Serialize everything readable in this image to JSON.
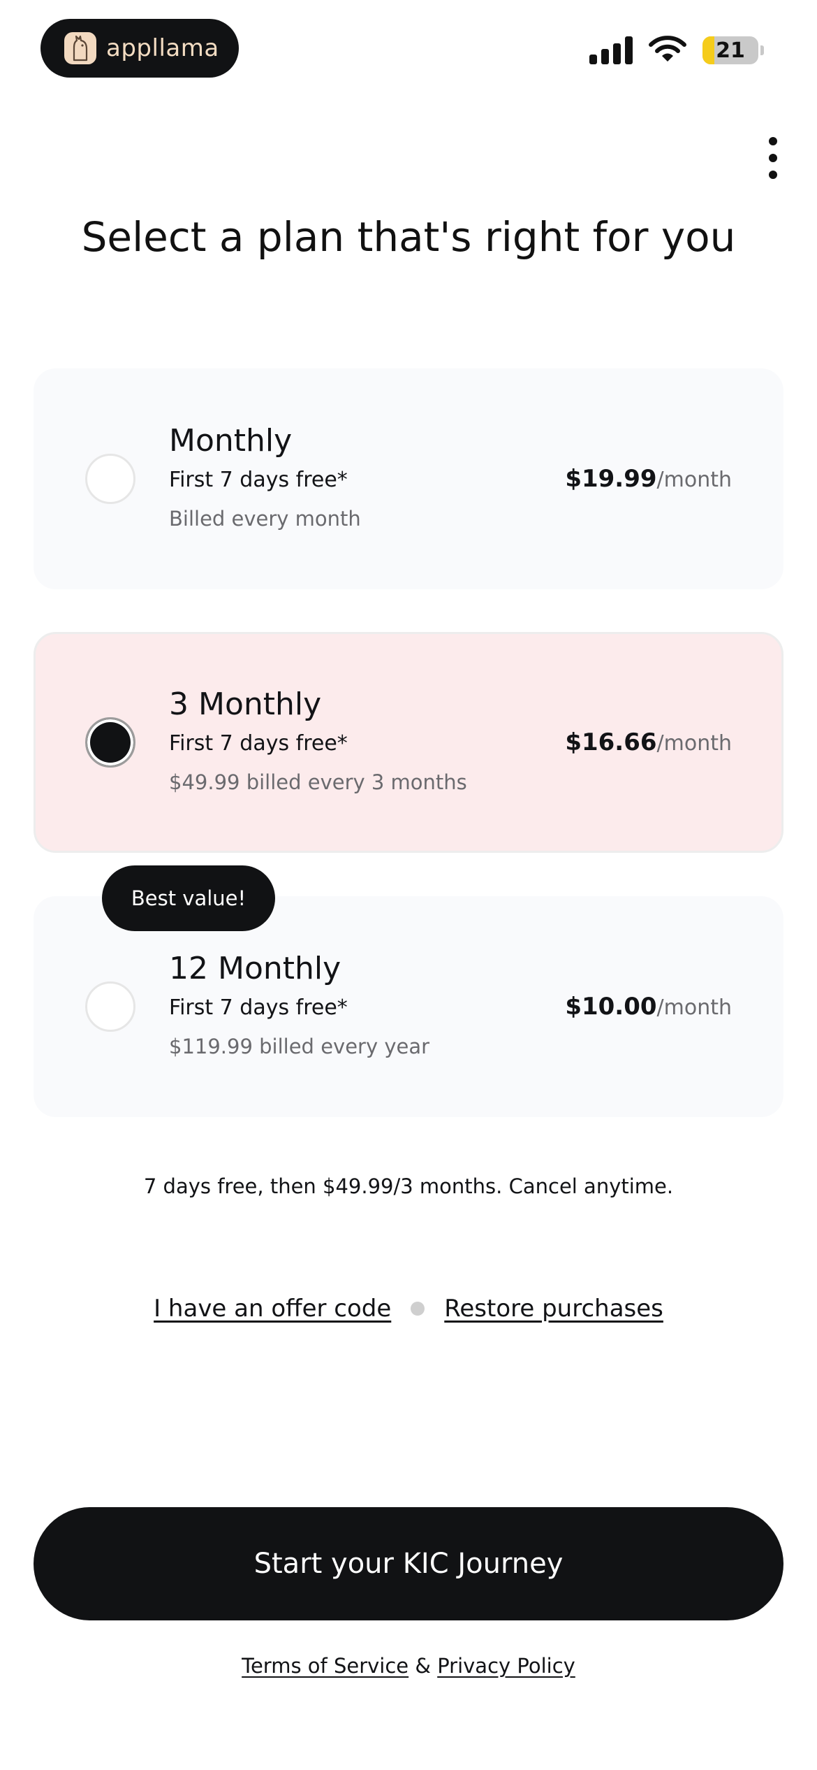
{
  "status_bar": {
    "app_brand": "appllama",
    "battery_level": "21",
    "battery_fraction": 0.21,
    "signal_icon": "cellular-signal-icon",
    "wifi_icon": "wifi-icon"
  },
  "header": {
    "title": "Select a plan that's right for you",
    "menu_icon": "more-vertical-icon"
  },
  "plans": [
    {
      "name": "Monthly",
      "trial": "First 7 days free*",
      "billing": "Billed every month",
      "price": "$19.99",
      "period": "/month",
      "selected": false
    },
    {
      "name": "3 Monthly",
      "trial": "First 7 days free*",
      "billing": "$49.99 billed every 3 months",
      "price": "$16.66",
      "period": "/month",
      "selected": true
    },
    {
      "name": "12 Monthly",
      "trial": "First 7 days free*",
      "billing": "$119.99 billed every year",
      "price": "$10.00",
      "period": "/month",
      "selected": false,
      "badge": "Best value!"
    }
  ],
  "disclaimer": "7 days free, then $49.99/3 months. Cancel anytime.",
  "links": {
    "offer_code": "I have an offer code",
    "restore": "Restore purchases"
  },
  "cta": {
    "label": "Start your KIC Journey"
  },
  "legal": {
    "terms": "Terms of Service",
    "separator": "&",
    "privacy": "Privacy Policy"
  },
  "colors": {
    "dark": "#111214",
    "selected_card_bg": "#fcebec",
    "card_bg": "#f9fafc",
    "brand_text": "#f3dcc2",
    "battery_fill": "#f5cc1b"
  }
}
